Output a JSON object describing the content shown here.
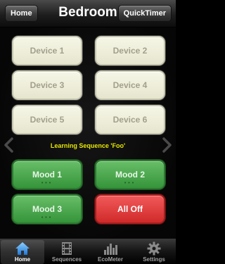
{
  "header": {
    "title": "Bedroom",
    "left_button": "Home",
    "right_button": "QuickTimer"
  },
  "devices": [
    {
      "label": "Device 1"
    },
    {
      "label": "Device 2"
    },
    {
      "label": "Device 3"
    },
    {
      "label": "Device 4"
    },
    {
      "label": "Device 5"
    },
    {
      "label": "Device 6"
    }
  ],
  "status_text": "Learning Sequence 'Foo'",
  "moods": [
    {
      "label": "Mood 1"
    },
    {
      "label": "Mood 2"
    },
    {
      "label": "Mood 3"
    }
  ],
  "all_off": {
    "label": "All Off"
  },
  "tabs": [
    {
      "label": "Home",
      "icon": "home-icon",
      "active": true
    },
    {
      "label": "Sequences",
      "icon": "film-icon",
      "active": false
    },
    {
      "label": "EcoMeter",
      "icon": "bar-chart-icon",
      "active": false
    },
    {
      "label": "Settings",
      "icon": "gear-icon",
      "active": false
    }
  ],
  "colors": {
    "device_bg": "#f2f2df",
    "mood_green": "#4caf50",
    "all_off_red": "#e03a3a",
    "status_yellow": "#e6e600"
  }
}
